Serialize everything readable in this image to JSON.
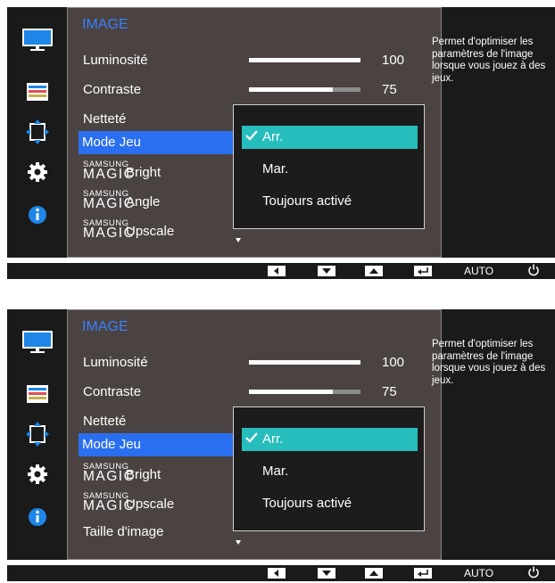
{
  "panels": [
    {
      "menu_title": "IMAGE",
      "items": [
        {
          "type": "plain",
          "label": "Luminosité"
        },
        {
          "type": "plain",
          "label": "Contraste"
        },
        {
          "type": "plain",
          "label": "Netteté"
        },
        {
          "type": "plain",
          "label": "Mode Jeu",
          "selected": true
        },
        {
          "type": "magic",
          "small": "SAMSUNG",
          "big": "MAGIC",
          "suffix": "Bright"
        },
        {
          "type": "magic",
          "small": "SAMSUNG",
          "big": "MAGIC",
          "suffix": "Angle"
        },
        {
          "type": "magic",
          "small": "SAMSUNG",
          "big": "MAGIC",
          "suffix": "Upscale"
        }
      ],
      "luminosite_value": "100",
      "luminosite_level": 1.0,
      "contraste_value": "75",
      "contraste_level": 0.75,
      "dropdown": [
        "Arr.",
        "Mar.",
        "Toujours activé"
      ],
      "dropdown_selected": 0,
      "description": "Permet d'optimiser les paramètres de l'image lorsque vous jouez à des jeux."
    },
    {
      "menu_title": "IMAGE",
      "items": [
        {
          "type": "plain",
          "label": "Luminosité"
        },
        {
          "type": "plain",
          "label": "Contraste"
        },
        {
          "type": "plain",
          "label": "Netteté"
        },
        {
          "type": "plain",
          "label": "Mode Jeu",
          "selected": true
        },
        {
          "type": "magic",
          "small": "SAMSUNG",
          "big": "MAGIC",
          "suffix": "Bright"
        },
        {
          "type": "magic",
          "small": "SAMSUNG",
          "big": "MAGIC",
          "suffix": "Upscale"
        },
        {
          "type": "plain",
          "label": "Taille d'image"
        }
      ],
      "luminosite_value": "100",
      "luminosite_level": 1.0,
      "contraste_value": "75",
      "contraste_level": 0.75,
      "dropdown": [
        "Arr.",
        "Mar.",
        "Toujours activé"
      ],
      "dropdown_selected": 0,
      "description": "Permet d'optimiser les paramètres de l'image lorsque vous jouez à des jeux."
    }
  ],
  "control_bar": {
    "auto_label": "AUTO",
    "icons": [
      "left-arrow-icon",
      "down-arrow-icon",
      "up-arrow-icon",
      "enter-icon",
      "power-icon"
    ]
  },
  "icons": [
    "monitor-icon",
    "color-bars-icon",
    "resize-icon",
    "gear-icon",
    "info-icon"
  ],
  "colors": {
    "selected_item": "#2a6ff0",
    "selected_option": "#27bdbd",
    "title": "#3b7fff",
    "menu_bg": "#4a4341"
  }
}
